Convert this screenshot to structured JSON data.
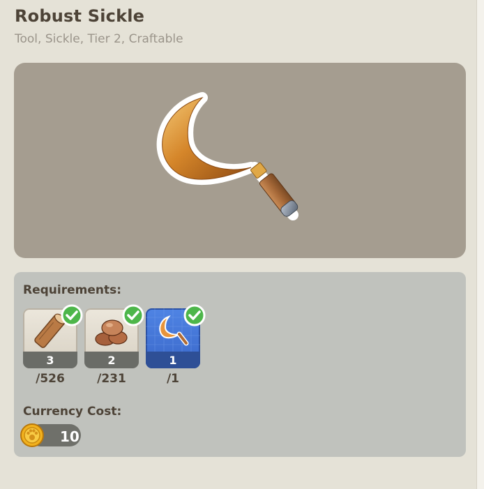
{
  "item": {
    "name": "Robust Sickle",
    "tags": "Tool, Sickle, Tier 2, Craftable",
    "image_icon": "sickle-icon"
  },
  "requirements": {
    "label": "Requirements:",
    "items": [
      {
        "icon": "wood-log-icon",
        "required": "3",
        "owned": "/526",
        "met": true
      },
      {
        "icon": "copper-ore-icon",
        "required": "2",
        "owned": "/231",
        "met": true
      },
      {
        "icon": "sickle-blueprint-icon",
        "required": "1",
        "owned": "/1",
        "met": true
      }
    ]
  },
  "currency": {
    "label": "Currency Cost:",
    "amount": "10",
    "icon": "gold-coin-icon"
  },
  "colors": {
    "background": "#e5e2d7",
    "preview_bg": "#a59d90",
    "panel_bg": "#c0c2bd",
    "text_dark": "#4d4337",
    "check_green": "#4db64a",
    "blueprint_blue": "#4f84e4"
  }
}
